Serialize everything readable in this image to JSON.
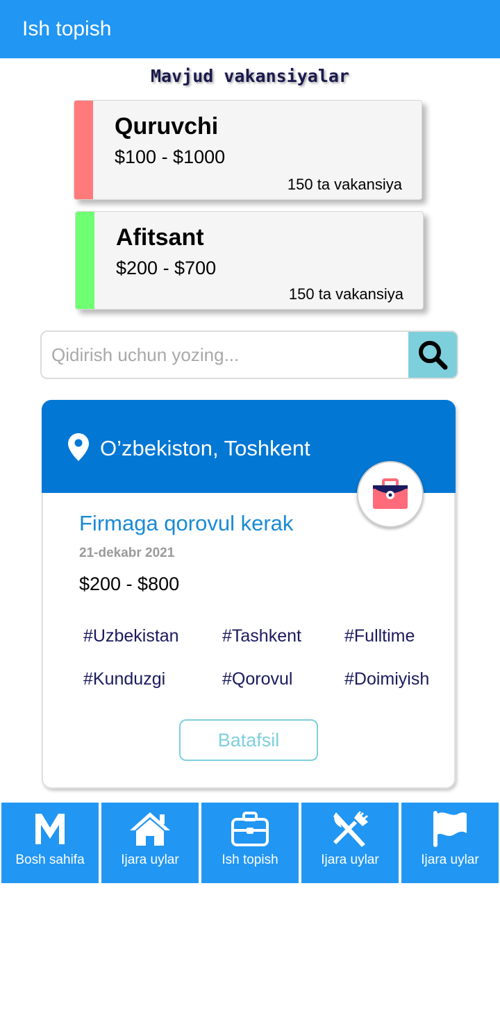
{
  "app_bar": {
    "title": "Ish topish",
    "color": "#2196F3"
  },
  "section_title": "Mavjud vakansiyalar",
  "categories": [
    {
      "name": "Quruvchi",
      "salary": "$100 - $1000",
      "count": "150 ta vakansiya",
      "accent": "#FF7B7B"
    },
    {
      "name": "Afitsant",
      "salary": "$200 - $700",
      "count": "150 ta vakansiya",
      "accent": "#6EFF72"
    }
  ],
  "search": {
    "placeholder": "Qidirish uchun yozing...",
    "value": "",
    "button_icon": "search-icon"
  },
  "job": {
    "location": "O’zbekiston, Toshkent",
    "title": "Firmaga qorovul kerak",
    "date": "21-dekabr 2021",
    "salary": "$200 - $800",
    "tags": [
      "#Uzbekistan",
      "#Tashkent",
      "#Fulltime",
      "#Kunduzgi",
      "#Qorovul",
      "#Doimiyish"
    ],
    "details_label": "Batafsil",
    "header_color": "#0277D4"
  },
  "bottom_nav": [
    {
      "label": "Bosh sahifa",
      "icon": "m-logo-icon"
    },
    {
      "label": "Ijara uylar",
      "icon": "home-icon"
    },
    {
      "label": "Ish topish",
      "icon": "briefcase-icon"
    },
    {
      "label": "Ijara uylar",
      "icon": "fork-knife-icon"
    },
    {
      "label": "Ijara uylar",
      "icon": "flag-icon"
    }
  ]
}
